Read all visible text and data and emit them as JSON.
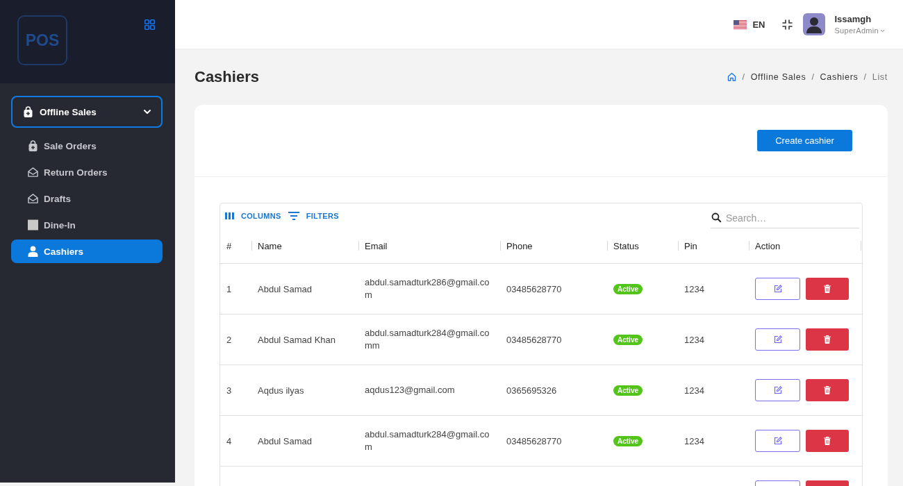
{
  "sidebar": {
    "logo": "POS",
    "menu_group": {
      "label": "Offline Sales",
      "expanded": true,
      "items": [
        {
          "label": "Sale Orders",
          "selected": false
        },
        {
          "label": "Return Orders",
          "selected": false
        },
        {
          "label": "Drafts",
          "selected": false
        },
        {
          "label": "Dine-In",
          "selected": false
        },
        {
          "label": "Cashiers",
          "selected": true
        }
      ]
    }
  },
  "header": {
    "language": "EN",
    "user": {
      "name": "Issamgh",
      "role": "SuperAdmin"
    }
  },
  "page": {
    "title": "Cashiers",
    "breadcrumb": {
      "separator": "/",
      "items": [
        "Offline Sales",
        "Cashiers",
        "List"
      ]
    }
  },
  "card": {
    "create_button": "Create cashier",
    "table": {
      "toolbar": {
        "columns_button": "COLUMNS",
        "filters_button": "FILTERS",
        "search": {
          "placeholder": "Search…"
        }
      },
      "columns": [
        "#",
        "Name",
        "Email",
        "Phone",
        "Status",
        "Pin",
        "Action"
      ],
      "rows": [
        {
          "kind": "full",
          "number": "1",
          "name": "Abdul Samad",
          "email": "abdul.samadturk286@gmail.com",
          "phone": "03485628770",
          "status": "Active",
          "pin": "1234"
        },
        {
          "kind": "full",
          "number": "2",
          "name": "Abdul Samad Khan",
          "email": "abdul.samadturk284@gmail.comm",
          "phone": "03485628770",
          "status": "Active",
          "pin": "1234"
        },
        {
          "kind": "full",
          "number": "3",
          "name": "Aqdus ilyas",
          "email": "aqdus123@gmail.com",
          "phone": "0365695326",
          "status": "Active",
          "pin": "1234"
        },
        {
          "kind": "full",
          "number": "4",
          "name": "Abdul Samad",
          "email": "abdul.samadturk284@gmail.com",
          "phone": "03485628770",
          "status": "Active",
          "pin": "1234"
        },
        {
          "kind": "partial"
        }
      ]
    }
  }
}
